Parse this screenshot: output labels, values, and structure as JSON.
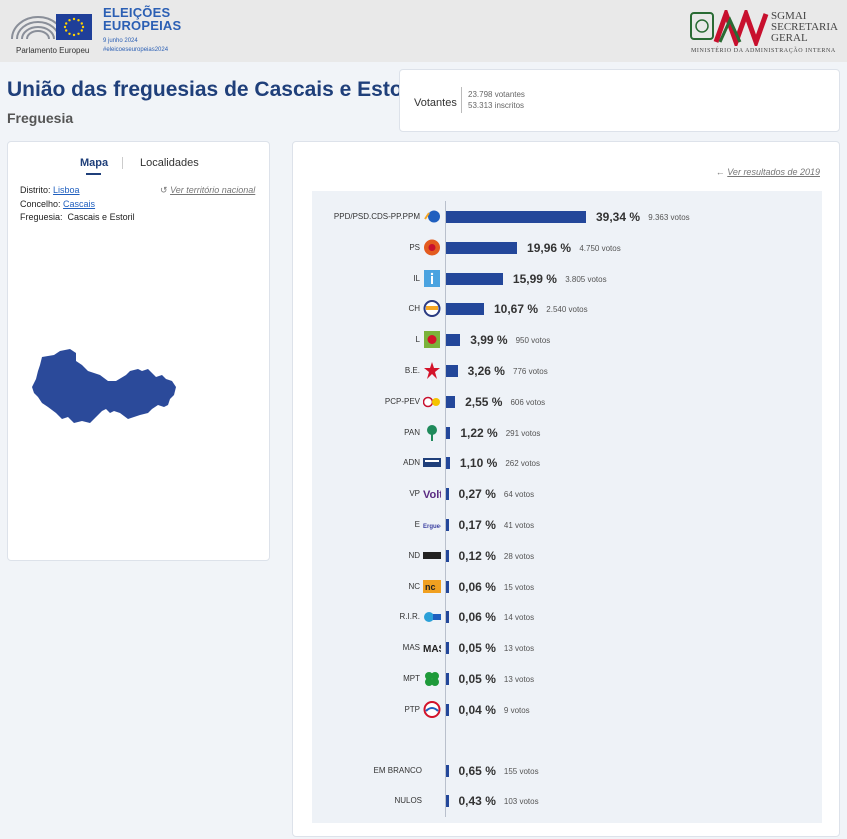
{
  "header": {
    "ep_label": "Parlamento Europeu",
    "elections_title": "ELEIÇÕES EUROPEIAS",
    "elections_date": "9 junho 2024",
    "elections_hashtag": "#eleicoeseuropeias2024",
    "sgmai_name": "SGMAI SECRETARIA GERAL",
    "ministry": "MINISTÉRIO DA ADMINISTRAÇÃO INTERNA"
  },
  "page": {
    "title": "União das freguesias de Cascais e Estoril",
    "subtitle": "Freguesia"
  },
  "votantes": {
    "label": "Votantes",
    "votantes_text": "23.798 votantes",
    "inscritos_text": "53.313 inscritos"
  },
  "map_panel": {
    "tabs": [
      "Mapa",
      "Localidades"
    ],
    "active_tab": "Mapa",
    "distrito_label": "Distrito:",
    "distrito_value": "Lisboa",
    "concelho_label": "Concelho:",
    "concelho_value": "Cascais",
    "freguesia_label": "Freguesia:",
    "freguesia_value": "Cascais e Estoril",
    "ver_territorio": "Ver território nacional",
    "map_color": "#2b4a9a"
  },
  "results": {
    "ver_2019": "Ver resultados de 2019",
    "bar_color": "#23479a"
  },
  "chart_data": {
    "type": "bar",
    "orientation": "horizontal",
    "max_value": 39.34,
    "rows": [
      {
        "party": "PPD/PSD.CDS-PP.PPM",
        "pct": 39.34,
        "pct_text": "39,34 %",
        "votes_text": "9.363 votos",
        "icon": "ad-coalition-icon",
        "icon_color": "#1f5fbf"
      },
      {
        "party": "PS",
        "pct": 19.96,
        "pct_text": "19,96 %",
        "votes_text": "4.750 votos",
        "icon": "ps-fist-rose-icon",
        "icon_color": "#e35b1f"
      },
      {
        "party": "IL",
        "pct": 15.99,
        "pct_text": "15,99 %",
        "votes_text": "3.805 votos",
        "icon": "il-icon",
        "icon_color": "#4aa3e0"
      },
      {
        "party": "CH",
        "pct": 10.67,
        "pct_text": "10,67 %",
        "votes_text": "2.540 votos",
        "icon": "chega-icon",
        "icon_color": "#2a3b82"
      },
      {
        "party": "L",
        "pct": 3.99,
        "pct_text": "3,99 %",
        "votes_text": "950 votos",
        "icon": "livre-poppy-icon",
        "icon_color": "#7bb33a"
      },
      {
        "party": "B.E.",
        "pct": 3.26,
        "pct_text": "3,26 %",
        "votes_text": "776 votos",
        "icon": "be-star-icon",
        "icon_color": "#d3132a"
      },
      {
        "party": "PCP-PEV",
        "pct": 2.55,
        "pct_text": "2,55 %",
        "votes_text": "606 votos",
        "icon": "cdu-icon",
        "icon_color": "#c8102e"
      },
      {
        "party": "PAN",
        "pct": 1.22,
        "pct_text": "1,22 %",
        "votes_text": "291 votos",
        "icon": "pan-tree-icon",
        "icon_color": "#1f8a5b"
      },
      {
        "party": "ADN",
        "pct": 1.1,
        "pct_text": "1,10 %",
        "votes_text": "262 votos",
        "icon": "adn-icon",
        "icon_color": "#1f3f7a"
      },
      {
        "party": "VP",
        "pct": 0.27,
        "pct_text": "0,27 %",
        "votes_text": "64 votos",
        "icon": "volt-icon",
        "icon_color": "#5a2a82"
      },
      {
        "party": "E",
        "pct": 0.17,
        "pct_text": "0,17 %",
        "votes_text": "41 votos",
        "icon": "ergue-te-icon",
        "icon_color": "#3a3fa0"
      },
      {
        "party": "ND",
        "pct": 0.12,
        "pct_text": "0,12 %",
        "votes_text": "28 votos",
        "icon": "nova-direita-icon",
        "icon_color": "#222222"
      },
      {
        "party": "NC",
        "pct": 0.06,
        "pct_text": "0,06 %",
        "votes_text": "15 votos",
        "icon": "nc-icon",
        "icon_color": "#f0a020"
      },
      {
        "party": "R.I.R.",
        "pct": 0.06,
        "pct_text": "0,06 %",
        "votes_text": "14 votos",
        "icon": "rir-icon",
        "icon_color": "#2aa0d8"
      },
      {
        "party": "MAS",
        "pct": 0.05,
        "pct_text": "0,05 %",
        "votes_text": "13 votos",
        "icon": "mas-icon",
        "icon_color": "#222222"
      },
      {
        "party": "MPT",
        "pct": 0.05,
        "pct_text": "0,05 %",
        "votes_text": "13 votos",
        "icon": "mpt-clover-icon",
        "icon_color": "#1e9a3a"
      },
      {
        "party": "PTP",
        "pct": 0.04,
        "pct_text": "0,04 %",
        "votes_text": "9 votos",
        "icon": "ptp-icon",
        "icon_color": "#d3132a"
      }
    ],
    "extra_rows": [
      {
        "party": "EM BRANCO",
        "pct": 0.65,
        "pct_text": "0,65 %",
        "votes_text": "155 votos"
      },
      {
        "party": "NULOS",
        "pct": 0.43,
        "pct_text": "0,43 %",
        "votes_text": "103 votos"
      }
    ]
  }
}
